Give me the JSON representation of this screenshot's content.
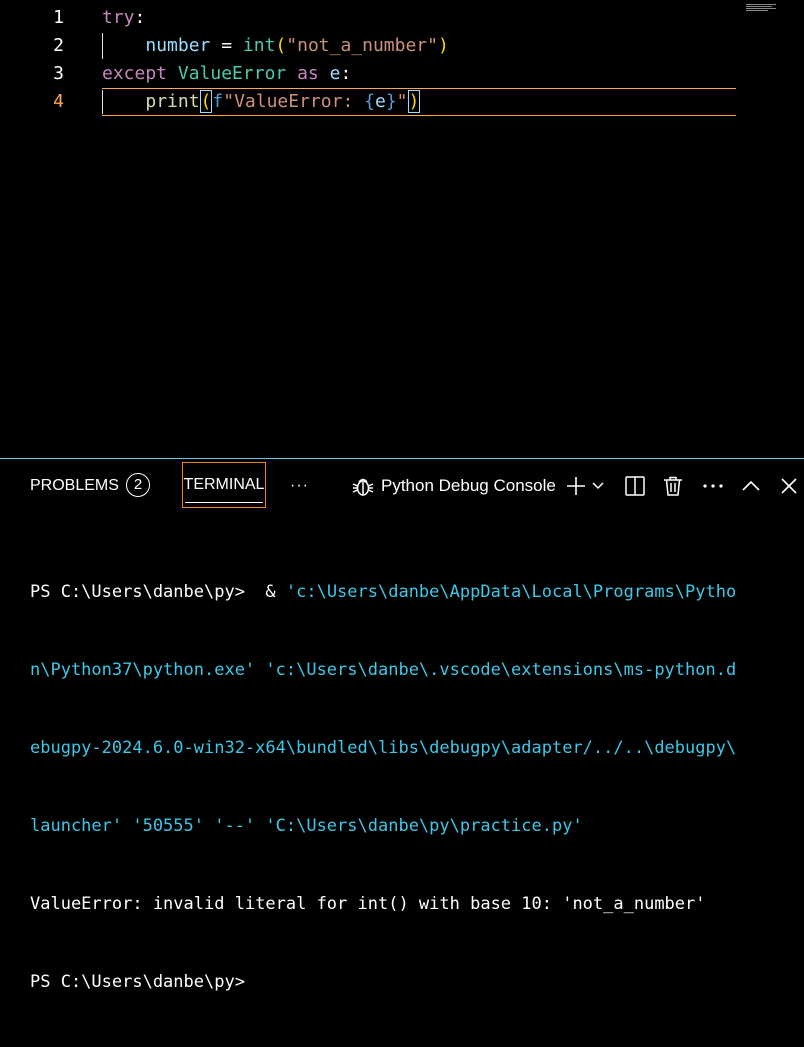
{
  "editor": {
    "lines": [
      {
        "number": "1",
        "tokens": {
          "kw": "try",
          "colon": ":"
        }
      },
      {
        "number": "2",
        "tokens": {
          "indent": "    ",
          "var": "number",
          "eq": " = ",
          "fn": "int",
          "po": "(",
          "str": "\"not_a_number\"",
          "pc": ")"
        }
      },
      {
        "number": "3",
        "tokens": {
          "kw": "except",
          "sp1": " ",
          "type": "ValueError",
          "sp2": " ",
          "as": "as",
          "sp3": " ",
          "var": "e",
          "colon": ":"
        }
      },
      {
        "number": "4",
        "tokens": {
          "indent": "    ",
          "fn": "print",
          "po": "(",
          "f": "f",
          "str1": "\"ValueError: ",
          "bo": "{",
          "var": "e",
          "bc": "}",
          "str2": "\"",
          "pc": ")"
        }
      }
    ]
  },
  "panel": {
    "tabs": {
      "problems": "PROBLEMS",
      "problems_count": "2",
      "terminal": "TERMINAL",
      "more": "···"
    },
    "debug_console_label": "Python Debug Console",
    "icons": {
      "debug": "bug-icon",
      "add": "plus-icon",
      "dropdown": "chevron-down-icon",
      "split": "split-icon",
      "trash": "trash-icon",
      "more": "more-icon",
      "maximize": "chevron-up-icon",
      "close": "close-icon"
    },
    "colors": {
      "accent_border": "#f38518",
      "panel_border": "#6fc3df",
      "terminal_path": "#3ec7e8"
    }
  },
  "terminal": {
    "line1_prompt": "PS C:\\Users\\danbe\\py>  & ",
    "line1_path": "'c:\\Users\\danbe\\AppData\\Local\\Programs\\Pytho",
    "line2": "n\\Python37\\python.exe' 'c:\\Users\\danbe\\.vscode\\extensions\\ms-python.d",
    "line3": "ebugpy-2024.6.0-win32-x64\\bundled\\libs\\debugpy\\adapter/../..\\debugpy\\",
    "line4": "launcher' '50555' '--' 'C:\\Users\\danbe\\py\\practice.py'",
    "line5": "ValueError: invalid literal for int() with base 10: 'not_a_number'",
    "line6": "PS C:\\Users\\danbe\\py>"
  }
}
